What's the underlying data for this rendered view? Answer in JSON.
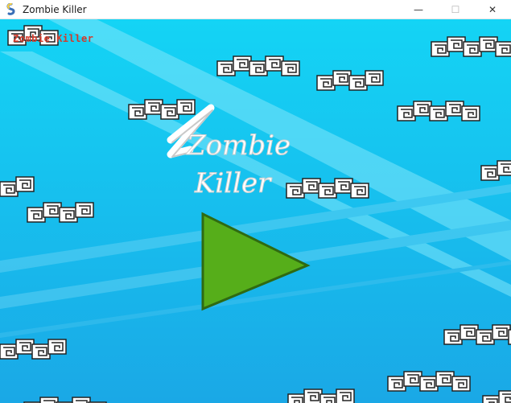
{
  "window": {
    "title": "Zombie Killer",
    "minimize_glyph": "—",
    "restore_glyph": "☐",
    "close_glyph": "✕",
    "app_icon": "snake-icon"
  },
  "game": {
    "caption": "Zombie Killer",
    "logo_line1": "Zombie",
    "logo_line2": "Killer",
    "play_icon": "play-triangle-icon",
    "colors": {
      "sky_top": "#14d4f5",
      "sky_bottom": "#1aa8e6",
      "play_fill": "#56ae1a",
      "play_edge": "#2f6a12",
      "caption": "#d43a2a"
    }
  }
}
